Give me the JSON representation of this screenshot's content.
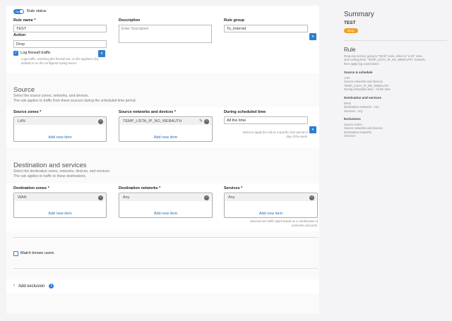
{
  "top": {
    "toggle_label": "On",
    "rule_status_label": "Rule status"
  },
  "rule_name": {
    "label": "Rule name",
    "value": "TEST"
  },
  "description": {
    "label": "Description",
    "placeholder": "Enter Description"
  },
  "rule_group": {
    "label": "Rule group",
    "value": "To_Internet"
  },
  "action": {
    "label": "Action",
    "value": "Drop"
  },
  "log_traffic": {
    "label": "Log firewall traffic",
    "checked": true,
    "hint_line1": "Logs traffic, matching this firewall rule, on the appliance (by",
    "hint_line2": "default) or on the configured syslog server."
  },
  "source": {
    "title": "Source",
    "desc_line1": "Select the source zones, networks, and devices.",
    "desc_line2": "The rule applies to traffic from these sources during the scheduled time period.",
    "zones_label": "Source zones",
    "zones_value": "LAN",
    "networks_label": "Source networks and devices",
    "networks_value": "TEMP_LISTA_IP_NO_WEBAUTH",
    "schedule_label": "During scheduled time",
    "schedule_value": "All the time",
    "schedule_hint_line1": "Select to apply the rule to a specific time period or",
    "schedule_hint_line2": "day of the week.",
    "add_new": "Add new item"
  },
  "destination": {
    "title": "Destination and services",
    "desc_line1": "Select the destination zones, networks, devices, and services.",
    "desc_line2": "The rule applies to traffic to these destinations.",
    "zones_label": "Destination zones",
    "zones_value": "WAN",
    "networks_label": "Destination networks",
    "networks_value": "Any",
    "services_label": "Services",
    "services_value": "Any",
    "services_hint_line1": "Services are traffic types based on a combination of",
    "services_hint_line2": "protocols and ports.",
    "add_new": "Add new item"
  },
  "match_known_users": {
    "label": "Match known users"
  },
  "exclusion": {
    "label": "Add exclusion"
  },
  "summary": {
    "title": "Summary",
    "rule_name": "TEST",
    "action_badge": "Drop",
    "rule_heading": "Rule",
    "rule_desc_line1": "Drop any service going to \"WAN\" zone, when in \"LAN\" zone,",
    "rule_desc_line2": "and coming from \"TEMP_LISTA_IP_NO_WEBAUTH\" network,",
    "rule_desc_line3": "then apply log connections",
    "src_heading": "Source & schedule",
    "src_lines": [
      "LAN",
      "Source networks and devices",
      "TEMP_LISTA_IP_NO_WEBAUTH",
      "During scheduled time : All the time"
    ],
    "dst_heading": "Destination and services",
    "dst_lines": [
      "WAN",
      "Destination networks : Any",
      "Services : Any"
    ],
    "excl_heading": "Exclusions",
    "excl_lines": [
      "Source zones",
      "Source networks and devices",
      "Destination networks",
      "Services"
    ]
  },
  "colors": {
    "accent": "#2f7fd0",
    "badge": "#f0a020",
    "link": "#2f6fb6"
  }
}
